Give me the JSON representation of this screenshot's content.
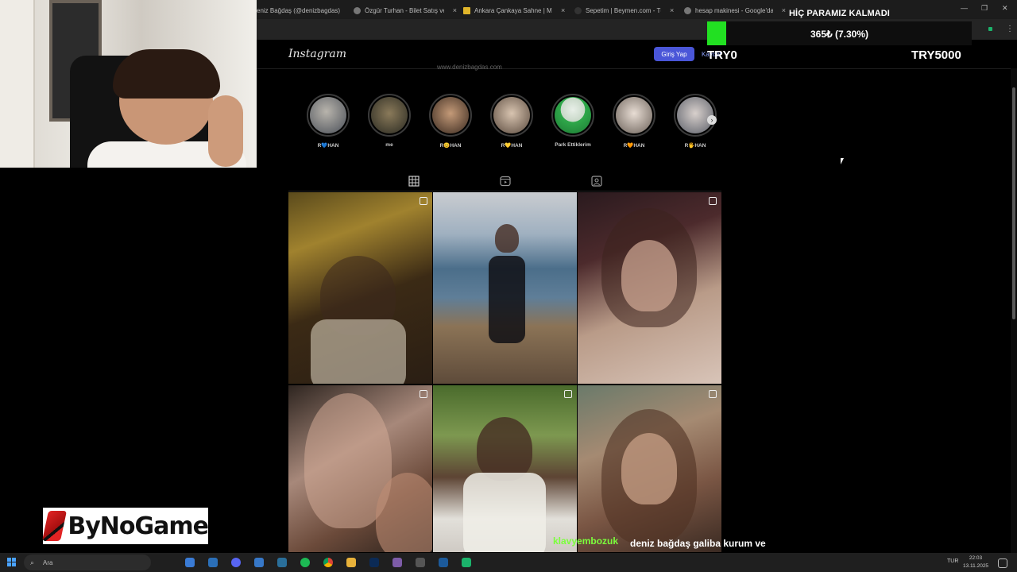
{
  "browser": {
    "tabs": [
      {
        "title": "eniz Bağdaş (@denizbagdas)",
        "fav": "#d13d7a"
      },
      {
        "title": "Özgür Turhan - Bilet Satış ve Kon",
        "fav": "#888888"
      },
      {
        "title": "Ankara Çankaya Sahne | Mekan",
        "fav": "#e0b52a"
      },
      {
        "title": "Sepetim | Beymen.com - Türkiye",
        "fav": "#333333"
      },
      {
        "title": "hesap makinesi - Google'da Ara",
        "fav": "#888888"
      }
    ],
    "close_glyph": "×",
    "window_controls": {
      "minimize": "—",
      "restore": "❐",
      "close": "✕"
    },
    "menu_glyph": "⋮"
  },
  "instagram": {
    "logo": "Instagram",
    "login_label": "Giriş Yap",
    "signup_label": "Kaydol",
    "website": "www.denizbagdas.com",
    "stories": [
      {
        "label": "R💙HAN",
        "color": "#6d7680"
      },
      {
        "label": "me",
        "color": "#4d4b3a"
      },
      {
        "label": "R😊HAN",
        "color": "#7a5a44"
      },
      {
        "label": "R💛HAN",
        "color": "#8a7a6a"
      },
      {
        "label": "Park Ettiklerim",
        "color": "#2fa84a"
      },
      {
        "label": "R🧡HAN",
        "color": "#b0a8a0"
      },
      {
        "label": "R🖐HAN",
        "color": "#a0a4ac"
      }
    ],
    "story_next_glyph": "›",
    "profile_tabs": [
      "grid-icon",
      "reels-icon",
      "tagged-icon"
    ]
  },
  "overlay": {
    "donation_title": "HİÇ PARAMIZ KALMADI",
    "donation_progress": 0.073,
    "donation_amount": "365₺ (7.30%)",
    "donation_min": "TRY0",
    "donation_max": "TRY5000",
    "brand_logo_text": "ByNoGame",
    "chat_user": "klavyembozuk",
    "chat_message": "deniz bağdaş galiba kurum ve kuruluş fonluyor"
  },
  "taskbar": {
    "search_placeholder": "Ara",
    "language": "TUR",
    "time": "22:03",
    "date": "13.11.2025"
  }
}
